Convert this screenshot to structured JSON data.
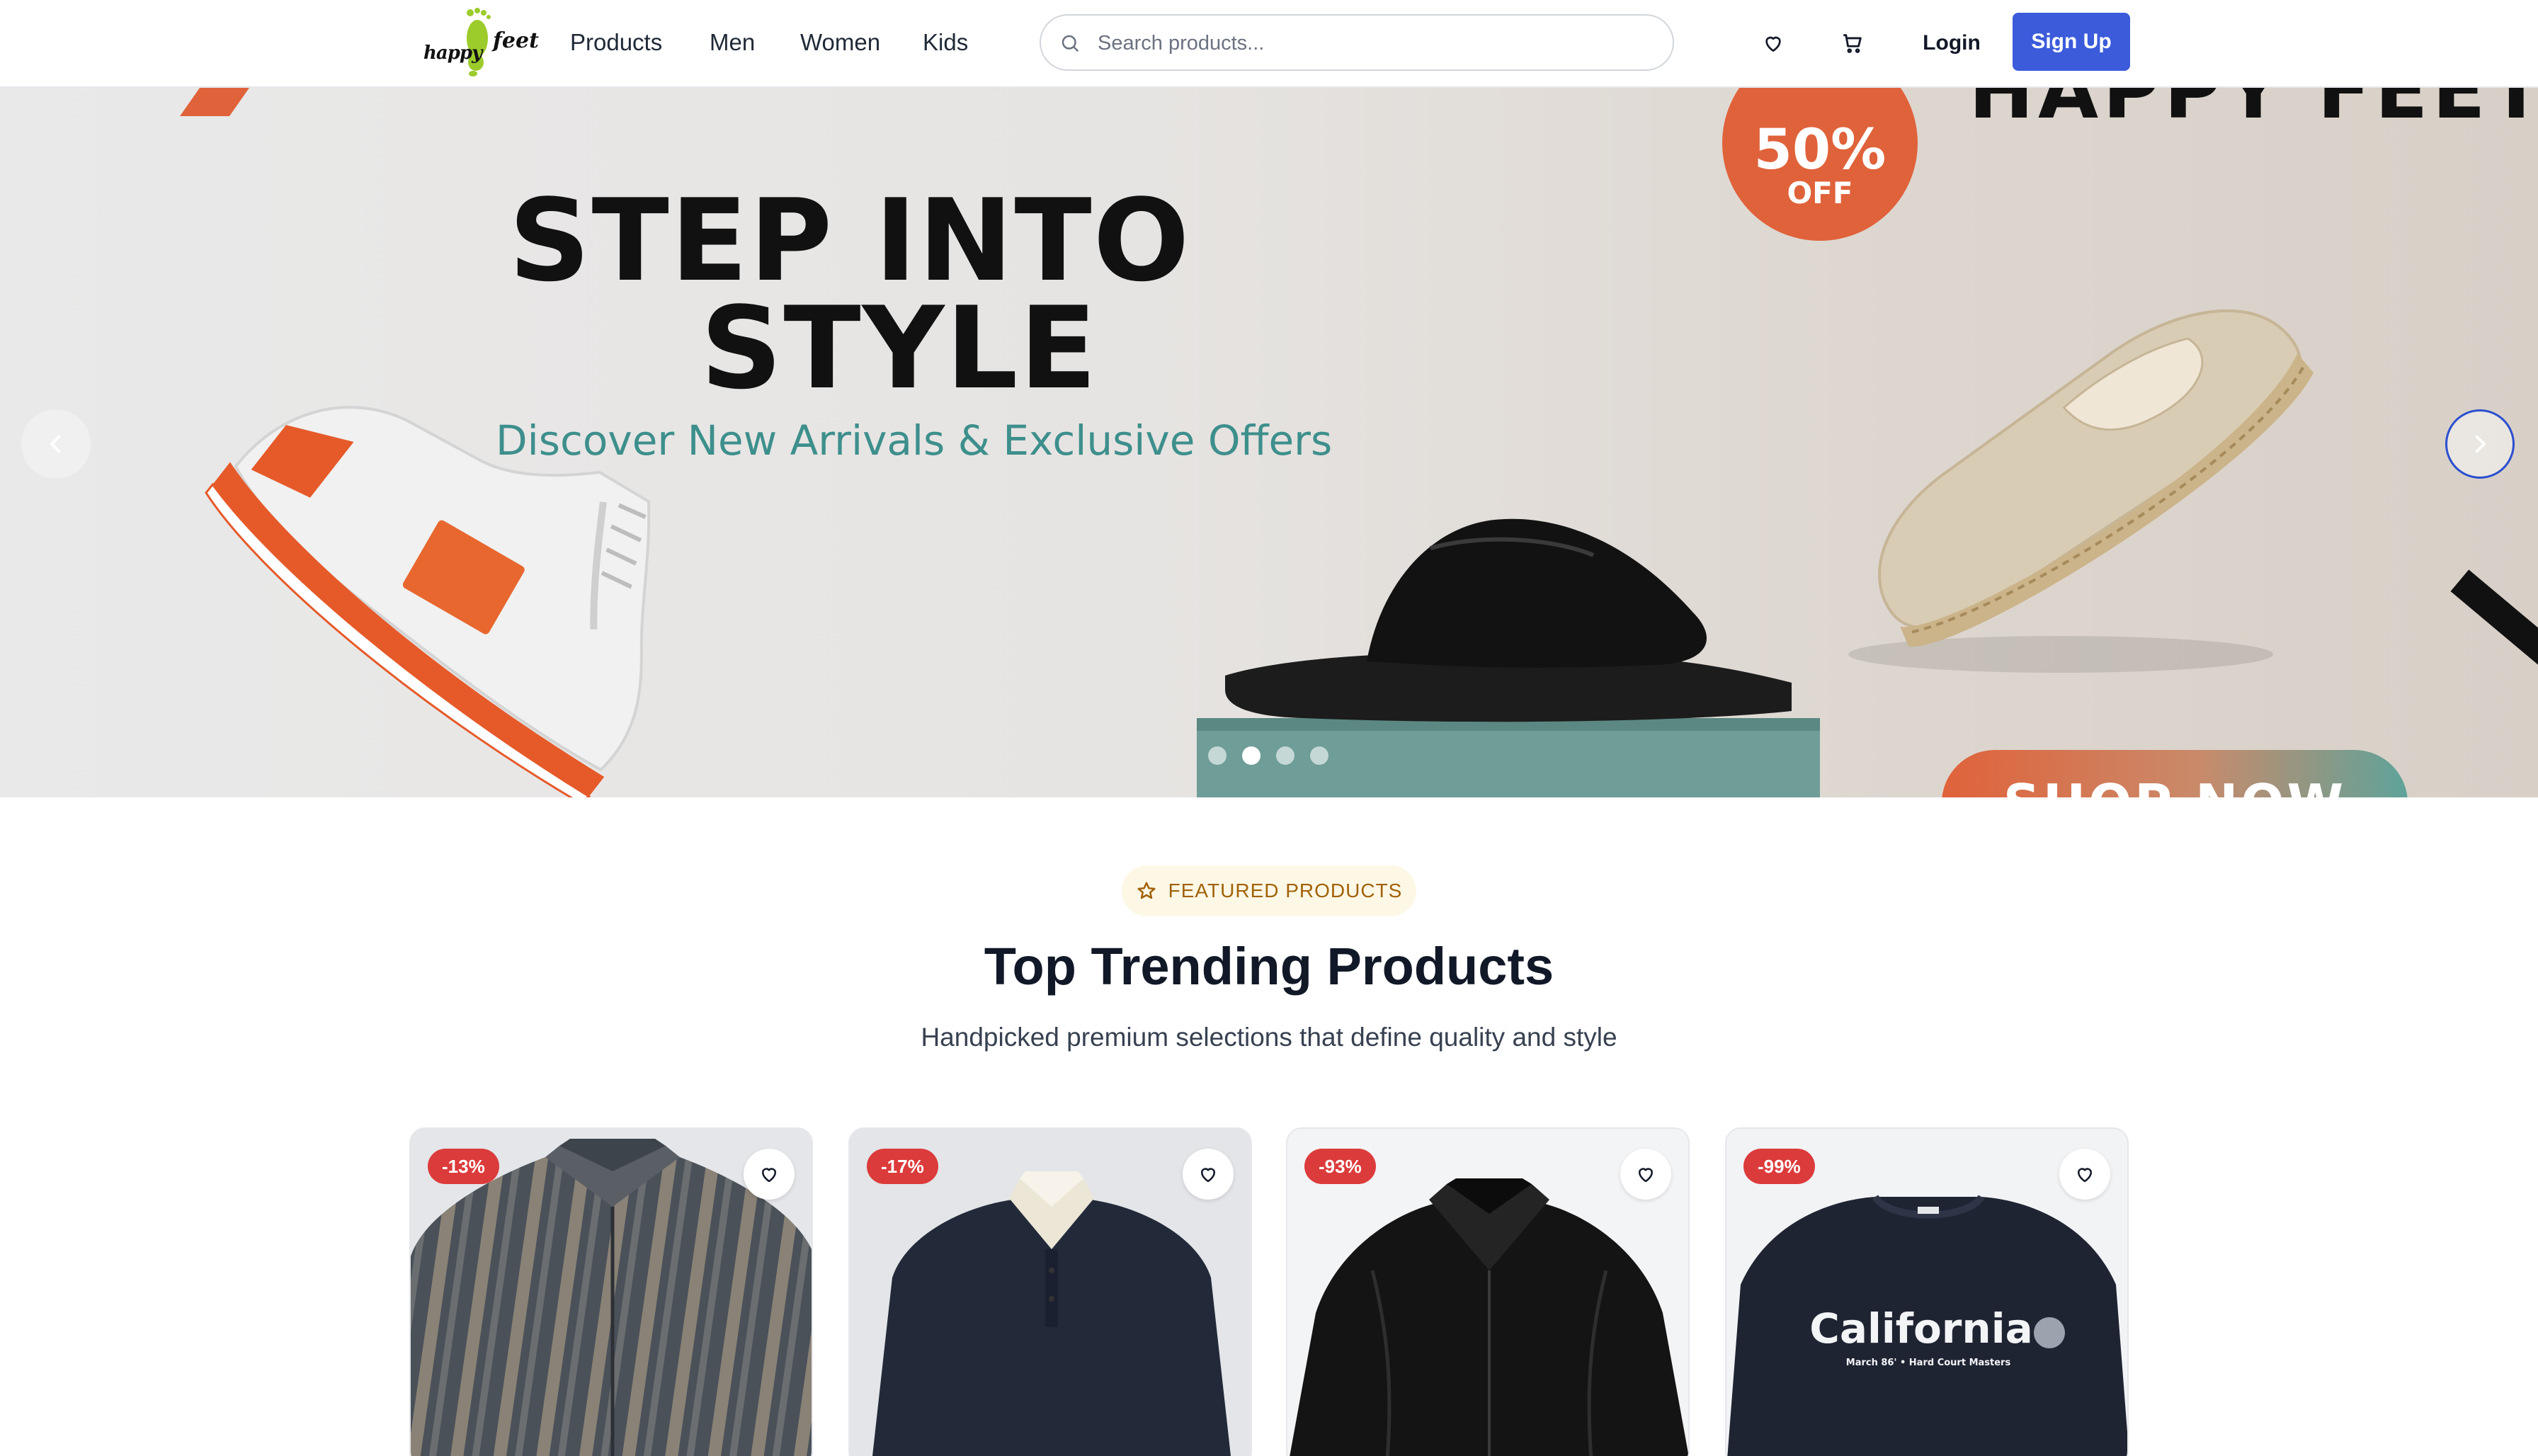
{
  "nav": {
    "logo_word1": "happy",
    "logo_word2": "feet",
    "links": [
      "Products",
      "Men",
      "Women",
      "Kids"
    ],
    "search_placeholder": "Search products...",
    "login": "Login",
    "signup": "Sign Up",
    "accent_color": "#3b5bdb"
  },
  "hero": {
    "title_line1": "STEP INTO",
    "title_line2": "STYLE",
    "subtitle": "Discover New Arrivals & Exclusive Offers",
    "badge_percent": "50%",
    "badge_off": "OFF",
    "brand": "HAPPY FEET",
    "cta": "SHOP NOW",
    "slide_count": 4,
    "active_slide": 2,
    "colors": {
      "orange": "#e0623a",
      "teal": "#3d8f8c"
    }
  },
  "featured": {
    "pill_label": "FEATURED PRODUCTS",
    "title": "Top Trending Products",
    "subtitle": "Handpicked premium selections that define quality and style"
  },
  "products": [
    {
      "discount": "-13%",
      "image": "patterned-zip-jacket"
    },
    {
      "discount": "-17%",
      "image": "navy-rugby-polo"
    },
    {
      "discount": "-93%",
      "image": "black-leather-jacket"
    },
    {
      "discount": "-99%",
      "image": "california-sweatshirt",
      "print_text": "California",
      "print_subtext": "March 86' • Hard Court Masters"
    }
  ]
}
